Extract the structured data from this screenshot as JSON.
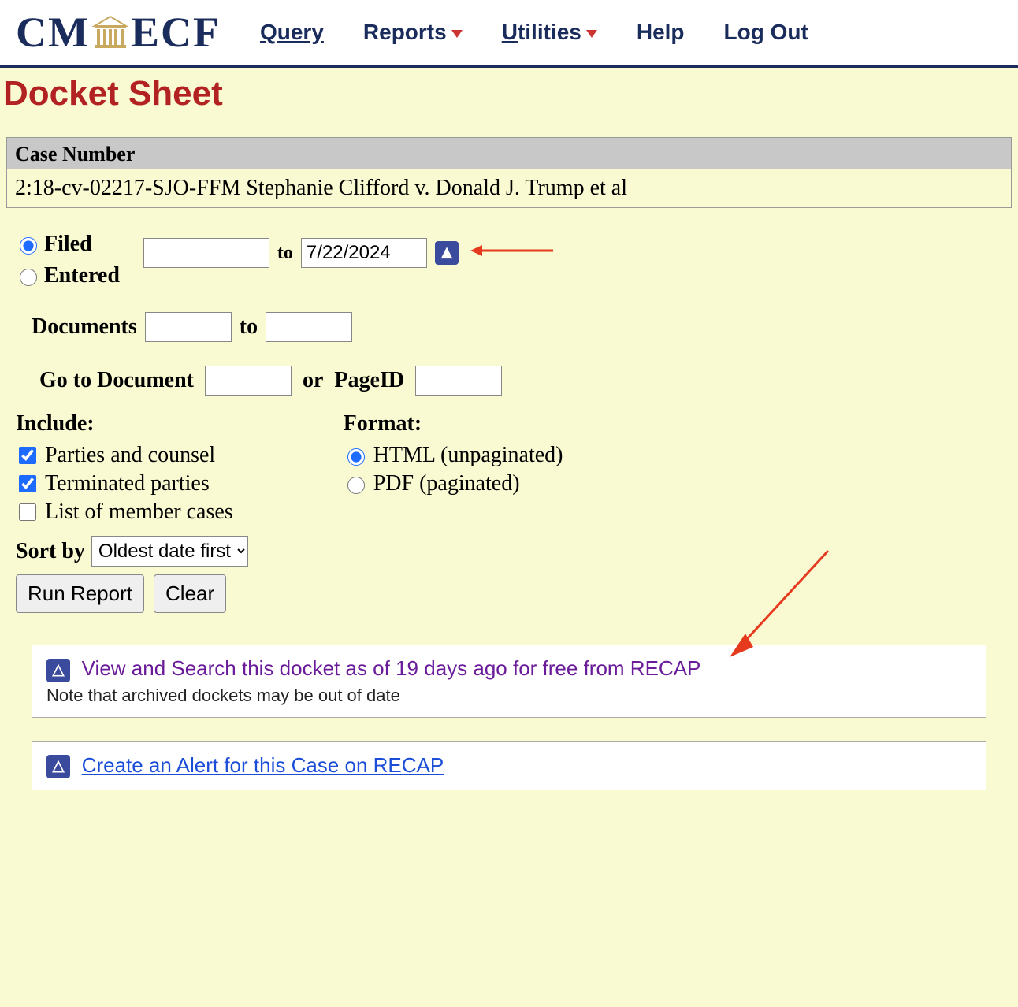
{
  "nav": {
    "query": "Query",
    "reports": "Reports",
    "utilities": "Utilities",
    "help": "Help",
    "logout": "Log Out"
  },
  "page_title": "Docket Sheet",
  "case": {
    "label": "Case Number",
    "value": "2:18-cv-02217-SJO-FFM Stephanie Clifford v. Donald J. Trump et al"
  },
  "date_filter": {
    "filed_label": "Filed",
    "entered_label": "Entered",
    "from_value": "",
    "to_label": "to",
    "to_value": "7/22/2024"
  },
  "documents": {
    "label": "Documents",
    "from_value": "",
    "to_label": "to",
    "to_value": ""
  },
  "goto": {
    "label": "Go to Document",
    "doc_value": "",
    "or_label": "or",
    "pageid_label": "PageID",
    "pageid_value": ""
  },
  "include": {
    "title": "Include:",
    "parties_counsel": "Parties and counsel",
    "terminated": "Terminated parties",
    "member_cases": "List of member cases"
  },
  "format": {
    "title": "Format:",
    "html": "HTML (unpaginated)",
    "pdf": "PDF (paginated)"
  },
  "sort": {
    "label": "Sort by",
    "selected": "Oldest date first"
  },
  "buttons": {
    "run": "Run Report",
    "clear": "Clear"
  },
  "recap_view": {
    "link": "View and Search this docket as of 19 days ago for free from RECAP",
    "note": "Note that archived dockets may be out of date"
  },
  "recap_alert": {
    "link": "Create an Alert for this Case on RECAP"
  }
}
